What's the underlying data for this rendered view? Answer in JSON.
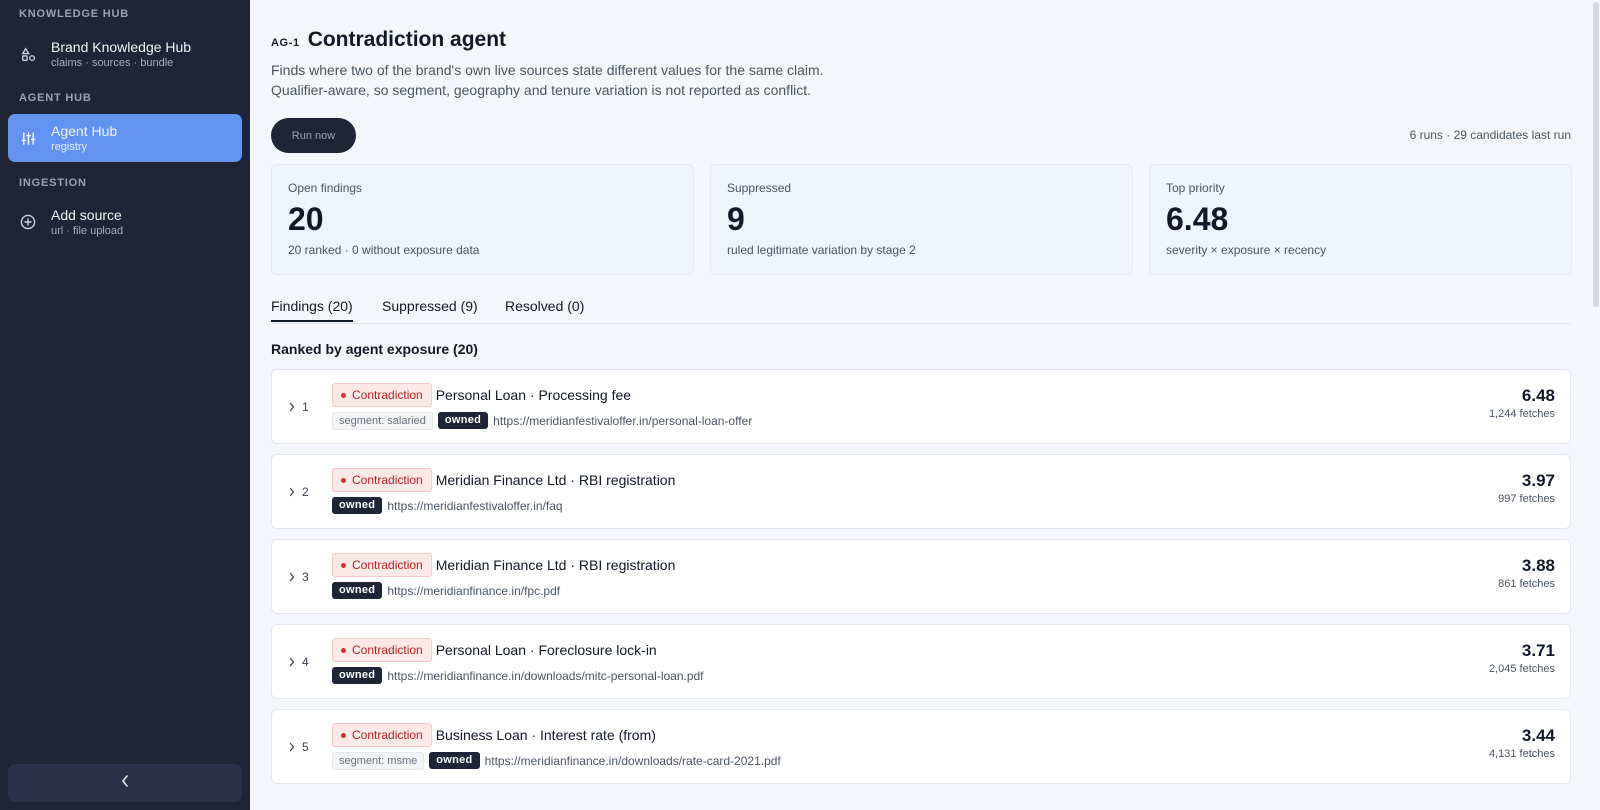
{
  "sidebar": {
    "sections": [
      {
        "label": "KNOWLEDGE HUB"
      },
      {
        "label": "AGENT HUB"
      },
      {
        "label": "INGESTION"
      }
    ],
    "items": [
      {
        "label": "Brand Knowledge Hub",
        "sub": "claims · sources · bundle",
        "icon": "shapes-icon"
      },
      {
        "label": "Agent Hub",
        "sub": "registry",
        "icon": "sliders-icon",
        "active": true
      },
      {
        "label": "Add source",
        "sub": "url · file upload",
        "icon": "plus-circle-icon"
      }
    ],
    "collapse_icon": "chevron-left-icon"
  },
  "header": {
    "code": "AG-1",
    "title": "Contradiction agent",
    "desc_line1": "Finds where two of the brand's own live sources state different values for the same claim.",
    "desc_line2": "Qualifier-aware, so segment, geography and tenure variation is not reported as conflict.",
    "run_label": "Run now",
    "runs_meta": "6 runs · 29 candidates last run"
  },
  "stats": [
    {
      "label": "Open findings",
      "value": "20",
      "sub": "20 ranked · 0 without exposure data"
    },
    {
      "label": "Suppressed",
      "value": "9",
      "sub": "ruled legitimate variation by stage 2"
    },
    {
      "label": "Top priority",
      "value": "6.48",
      "sub": "severity × exposure × recency"
    }
  ],
  "tabs": [
    {
      "label": "Findings (20)",
      "active": true
    },
    {
      "label": "Suppressed (9)"
    },
    {
      "label": "Resolved (0)"
    }
  ],
  "list_heading": "Ranked by agent exposure (20)",
  "badge_label": "Contradiction",
  "owned_label": "owned",
  "colors": {
    "sidebar_bg": "#1f2537",
    "active_nav": "#6293f0",
    "contradiction_red": "#b42323",
    "owned_chip": "#1f2537"
  },
  "findings": [
    {
      "rank": "1",
      "title": "Personal Loan · Processing fee",
      "segment": "segment: salaried",
      "url": "https://meridianfestivaloffer.in/personal-loan-offer",
      "score": "6.48",
      "fetches": "1,244 fetches"
    },
    {
      "rank": "2",
      "title": "Meridian Finance Ltd · RBI registration",
      "segment": "",
      "url": "https://meridianfestivaloffer.in/faq",
      "score": "3.97",
      "fetches": "997 fetches"
    },
    {
      "rank": "3",
      "title": "Meridian Finance Ltd · RBI registration",
      "segment": "",
      "url": "https://meridianfinance.in/fpc.pdf",
      "score": "3.88",
      "fetches": "861 fetches"
    },
    {
      "rank": "4",
      "title": "Personal Loan · Foreclosure lock-in",
      "segment": "",
      "url": "https://meridianfinance.in/downloads/mitc-personal-loan.pdf",
      "score": "3.71",
      "fetches": "2,045 fetches"
    },
    {
      "rank": "5",
      "title": "Business Loan · Interest rate (from)",
      "segment": "segment: msme",
      "url": "https://meridianfinance.in/downloads/rate-card-2021.pdf",
      "score": "3.44",
      "fetches": "4,131 fetches"
    }
  ]
}
